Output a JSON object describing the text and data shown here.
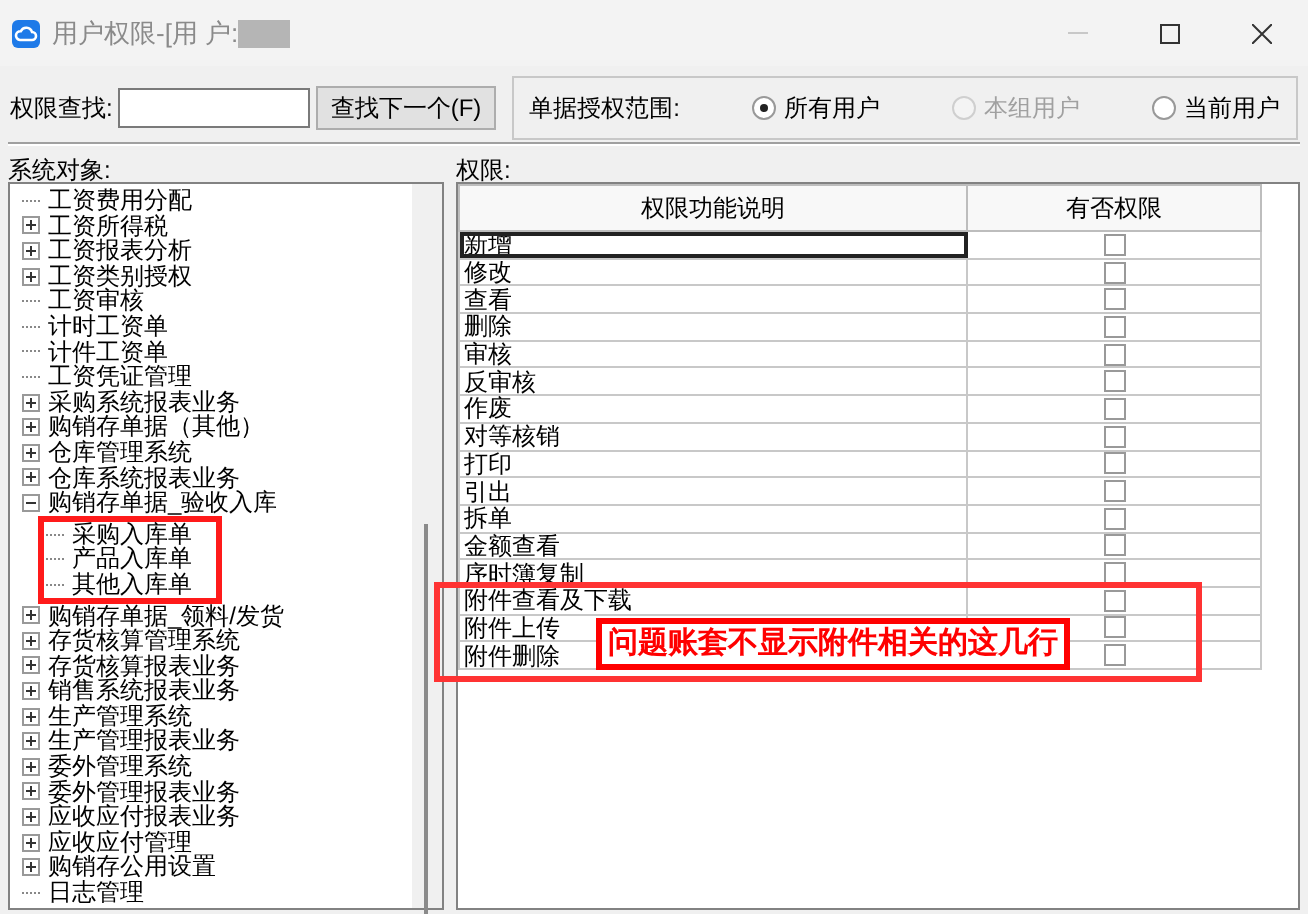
{
  "window": {
    "title": "用户权限-[用 户:",
    "user_hidden": true
  },
  "search": {
    "label": "权限查找:",
    "button": "查找下一个(F)"
  },
  "scope": {
    "label": "单据授权范围:",
    "options": [
      {
        "label": "所有用户",
        "selected": true,
        "disabled": false
      },
      {
        "label": "本组用户",
        "selected": false,
        "disabled": true
      },
      {
        "label": "当前用户",
        "selected": false,
        "disabled": false
      }
    ]
  },
  "tree": {
    "label": "系统对象:",
    "items": [
      {
        "label": "工资费用分配",
        "kind": "leaf"
      },
      {
        "label": "工资所得税",
        "kind": "branch",
        "expanded": false
      },
      {
        "label": "工资报表分析",
        "kind": "branch",
        "expanded": false
      },
      {
        "label": "工资类别授权",
        "kind": "branch",
        "expanded": false
      },
      {
        "label": "工资审核",
        "kind": "leaf"
      },
      {
        "label": "计时工资单",
        "kind": "leaf"
      },
      {
        "label": "计件工资单",
        "kind": "leaf"
      },
      {
        "label": "工资凭证管理",
        "kind": "leaf"
      },
      {
        "label": "采购系统报表业务",
        "kind": "branch",
        "expanded": false
      },
      {
        "label": "购销存单据（其他）",
        "kind": "branch",
        "expanded": false
      },
      {
        "label": "仓库管理系统",
        "kind": "branch",
        "expanded": false
      },
      {
        "label": "仓库系统报表业务",
        "kind": "branch",
        "expanded": false
      },
      {
        "label": "购销存单据_验收入库",
        "kind": "branch",
        "expanded": true,
        "children": [
          {
            "label": "采购入库单",
            "kind": "leaf",
            "highlighted": true
          },
          {
            "label": "产品入库单",
            "kind": "leaf",
            "highlighted": true
          },
          {
            "label": "其他入库单",
            "kind": "leaf",
            "highlighted": true
          }
        ]
      },
      {
        "label": "购销存单据_领料/发货",
        "kind": "branch",
        "expanded": false
      },
      {
        "label": "存货核算管理系统",
        "kind": "branch",
        "expanded": false
      },
      {
        "label": "存货核算报表业务",
        "kind": "branch",
        "expanded": false
      },
      {
        "label": "销售系统报表业务",
        "kind": "branch",
        "expanded": false
      },
      {
        "label": "生产管理系统",
        "kind": "branch",
        "expanded": false
      },
      {
        "label": "生产管理报表业务",
        "kind": "branch",
        "expanded": false
      },
      {
        "label": "委外管理系统",
        "kind": "branch",
        "expanded": false
      },
      {
        "label": "委外管理报表业务",
        "kind": "branch",
        "expanded": false
      },
      {
        "label": "应收应付报表业务",
        "kind": "branch",
        "expanded": false
      },
      {
        "label": "应收应付管理",
        "kind": "branch",
        "expanded": false
      },
      {
        "label": "购销存公用设置",
        "kind": "branch",
        "expanded": false
      },
      {
        "label": "日志管理",
        "kind": "leaf"
      }
    ]
  },
  "grid": {
    "label": "权限:",
    "columns": [
      "权限功能说明",
      "有否权限"
    ],
    "rows": [
      {
        "name": "新增",
        "checked": false,
        "selected": true
      },
      {
        "name": "修改",
        "checked": false,
        "selected": false
      },
      {
        "name": "查看",
        "checked": false,
        "selected": false
      },
      {
        "name": "删除",
        "checked": false,
        "selected": false
      },
      {
        "name": "审核",
        "checked": false,
        "selected": false
      },
      {
        "name": "反审核",
        "checked": false,
        "selected": false
      },
      {
        "name": "作废",
        "checked": false,
        "selected": false
      },
      {
        "name": "对等核销",
        "checked": false,
        "selected": false
      },
      {
        "name": "打印",
        "checked": false,
        "selected": false
      },
      {
        "name": "引出",
        "checked": false,
        "selected": false
      },
      {
        "name": "拆单",
        "checked": false,
        "selected": false
      },
      {
        "name": "金额查看",
        "checked": false,
        "selected": false
      },
      {
        "name": "序时簿复制",
        "checked": false,
        "selected": false
      },
      {
        "name": "附件查看及下载",
        "checked": false,
        "selected": false,
        "highlighted": true
      },
      {
        "name": "附件上传",
        "checked": false,
        "selected": false,
        "highlighted": true
      },
      {
        "name": "附件删除",
        "checked": false,
        "selected": false,
        "highlighted": true
      }
    ]
  },
  "annotation": {
    "text": "问题账套不显示附件相关的这几行"
  }
}
